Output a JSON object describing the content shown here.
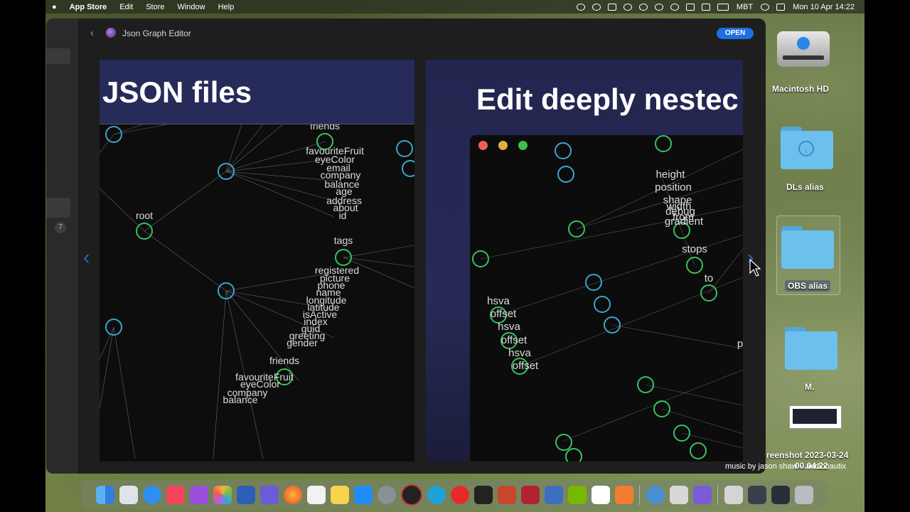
{
  "menubar": {
    "app_name": "App Store",
    "menus": [
      "Edit",
      "Store",
      "Window",
      "Help"
    ],
    "status_text": "MBT",
    "datetime": "Mon 10 Apr  14:22"
  },
  "window": {
    "back_glyph": "‹",
    "app_title": "Json Graph Editor",
    "open_button": "OPEN",
    "sidebar_badge": "7"
  },
  "screenshots": {
    "shot1_title": "JSON files",
    "shot2_title": "Edit deeply nestec",
    "prev_glyph": "‹",
    "next_glyph": "›"
  },
  "graph1_labels": [
    "root",
    "friends",
    "favouriteFruit",
    "eyeColor",
    "email",
    "company",
    "balance",
    "age",
    "address",
    "about",
    "id",
    "tags",
    "registered",
    "picture",
    "phone",
    "name",
    "longitude",
    "latitude",
    "isActive",
    "index",
    "guid",
    "greeting",
    "gender",
    "friends",
    "favouriteFruit",
    "eyeColor",
    "company",
    "balance"
  ],
  "graph2_labels": [
    "height",
    "position",
    "shape",
    "width",
    "debug",
    "from",
    "gradient",
    "stops",
    "to",
    "hsva",
    "offset",
    "hsva",
    "offset",
    "hsva",
    "offset",
    "p"
  ],
  "desktop": {
    "macintosh_hd": "Macintosh HD",
    "dls_alias": "DLs alias",
    "obs_alias": "OBS alias",
    "m_folder": "M.",
    "screenshot_name": "reenshot 2023-03-24",
    "screenshot_time": "00.04.22",
    "music_credit": "music by jason shaw – audionautix"
  },
  "dock_icons": [
    "finder-icon",
    "launchpad-icon",
    "safari-icon",
    "music-icon",
    "podcasts-icon",
    "photos-icon",
    "word-icon",
    "shortcuts-icon",
    "firefox-icon",
    "textedit-icon",
    "notes-icon",
    "app-store-icon",
    "system-settings-icon",
    "opera-gx-icon",
    "edge-icon",
    "opera-icon",
    "activity-monitor-icon",
    "powerpoint-icon",
    "photo-booth-icon",
    "lexicon-icon",
    "nvidia-icon",
    "calendar-icon",
    "sublime-icon",
    "preview-icon",
    "printer-icon",
    "affinity-icon",
    "music-file-icon",
    "screenshot-stack-icon",
    "folder-stack-icon",
    "trash-icon"
  ],
  "colors": {
    "accent": "#1f6fe0",
    "graph_green": "#37c45f",
    "graph_blue": "#3ca6d0",
    "window_bg": "#1e1e1e"
  }
}
